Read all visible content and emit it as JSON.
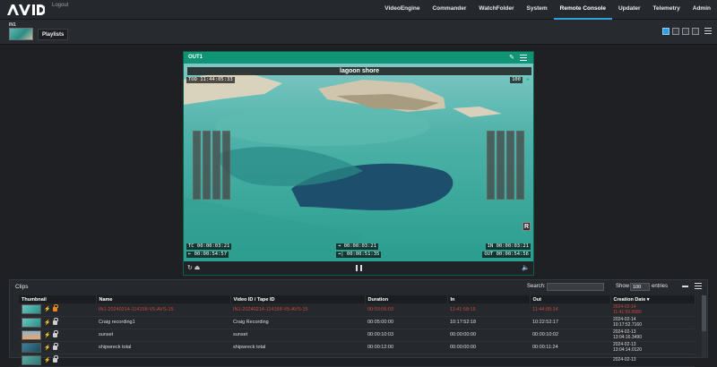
{
  "app": {
    "logo_text": "AVID",
    "logout_label": "Logout"
  },
  "nav": {
    "items": [
      {
        "label": "VideoEngine"
      },
      {
        "label": "Commander"
      },
      {
        "label": "WatchFolder"
      },
      {
        "label": "System"
      },
      {
        "label": "Remote Console",
        "active": true
      },
      {
        "label": "Updater"
      },
      {
        "label": "Telemetry"
      },
      {
        "label": "Admin"
      }
    ]
  },
  "subbar": {
    "channel_label": "IN1",
    "playlists_label": "Playlists",
    "view_icons": [
      "single-view-icon",
      "grid-view-icon",
      "quad-view-icon",
      "list-view-icon"
    ]
  },
  "player": {
    "output_label": "OUT1",
    "clip_title": "lagoon shore",
    "tod": "TOD 11:44:05:33",
    "level": "100",
    "tc": "TC  00:00:03:21",
    "remaining": "⇤ 00:00:54:57",
    "in_point": "⇥ 00:00:03:21",
    "out_remaining": "⇥| 00:00:51:35",
    "in_tc": "IN  00:00:03:21",
    "out_tc": "OUT 00:00:54:56",
    "r_badge": "R",
    "icons": {
      "settings": "wrench-icon",
      "menu": "menu-icon",
      "loop": "loop-icon",
      "eject": "eject-icon",
      "pause": "pause-icon",
      "volume": "volume-icon"
    }
  },
  "clips": {
    "title": "Clips",
    "search_label": "Search:",
    "search_value": "",
    "show_label": "Show",
    "show_value": "100",
    "entries_label": "entries",
    "columns": [
      "Thumbnail",
      "Name",
      "Video ID / Tape ID",
      "Duration",
      "In",
      "Out",
      "Creation Date"
    ],
    "rows": [
      {
        "name": "IN1-20240214-114158-V5-AVS-15",
        "video_id": "IN1-20240214-114158-V5-AVS-15",
        "duration": "00:03:06:03",
        "in": "11:41:58:15",
        "out": "11:44:05:14",
        "date1": "2024-02-14",
        "date2": "11:41:59.0580",
        "recording": true,
        "lock": "orange"
      },
      {
        "name": "Craig recording1",
        "video_id": "Craig Recording",
        "duration": "00:05:00:00",
        "in": "10:17:52:18",
        "out": "10:22:52:17",
        "date1": "2024-02-14",
        "date2": "10:17:52.7160",
        "recording": false,
        "lock": "gray"
      },
      {
        "name": "sunset",
        "video_id": "sunset",
        "duration": "00:00:10:03",
        "in": "00:00:00:00",
        "out": "00:00:10:02",
        "date1": "2024-02-13",
        "date2": "13:04:16.3490",
        "recording": false,
        "lock": "gray"
      },
      {
        "name": "shipwreck total",
        "video_id": "shipwreck total",
        "duration": "00:00:12:00",
        "in": "00:00:00:00",
        "out": "00:00:11:24",
        "date1": "2024-02-13",
        "date2": "13:04:14.0120",
        "recording": false,
        "lock": "gray"
      },
      {
        "name": "",
        "video_id": "",
        "duration": "",
        "in": "",
        "out": "",
        "date1": "2024-02-13",
        "date2": "",
        "recording": false,
        "lock": "gray"
      }
    ]
  },
  "colors": {
    "accent": "#2f9fe0",
    "player_header": "#0f9575",
    "recording_text": "#c9483b",
    "lock_active": "#e88a1a"
  }
}
